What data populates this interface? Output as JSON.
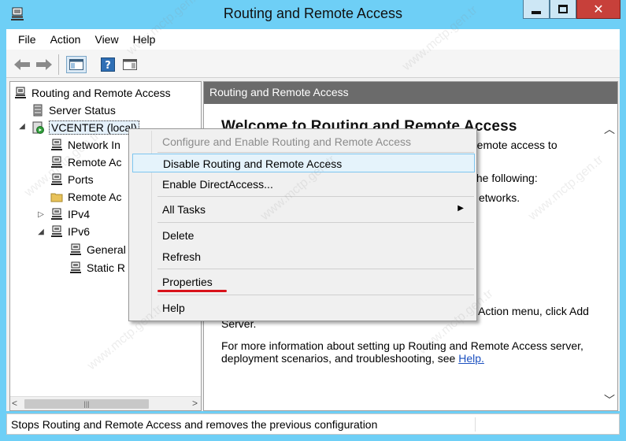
{
  "window": {
    "title": "Routing and Remote Access"
  },
  "menubar": [
    "File",
    "Action",
    "View",
    "Help"
  ],
  "tree": {
    "root": "Routing and Remote Access",
    "server_status": "Server Status",
    "server": "VCENTER (local)",
    "network_interfaces": "Network In",
    "remote_access_clients": "Remote Ac",
    "ports": "Ports",
    "remote_access_logging": "Remote Ac",
    "ipv4": "IPv4",
    "ipv6": "IPv6",
    "general": "General",
    "static_routes": "Static R"
  },
  "right_pane": {
    "header": "Routing and Remote Access",
    "welcome": "Welcome to Routing and Remote Access",
    "line1_tail": "remote access to",
    "line2_tail": "the following:",
    "line3_tail": "etworks.",
    "add_server": "To add a Routing and Remote Access server, on the Action menu, click Add Server.",
    "more_info": "For more information about setting up Routing and Remote Access server, deployment scenarios, and troubleshooting, see",
    "help_link": "Help."
  },
  "context_menu": {
    "configure": "Configure and Enable Routing and Remote Access",
    "disable": "Disable Routing and Remote Access",
    "enable_direct": "Enable DirectAccess...",
    "all_tasks": "All Tasks",
    "delete": "Delete",
    "refresh": "Refresh",
    "properties": "Properties",
    "help": "Help"
  },
  "statusbar": {
    "text": "Stops Routing and Remote Access and removes the previous configuration"
  },
  "watermark": "www.mctp.gen.tr",
  "colors": {
    "titlebar": "#6ecff6",
    "close": "#c7403a",
    "header": "#6b6b6b",
    "highlight": "#e5f3fb",
    "underline": "#d9121a",
    "link": "#1a4fbf"
  }
}
